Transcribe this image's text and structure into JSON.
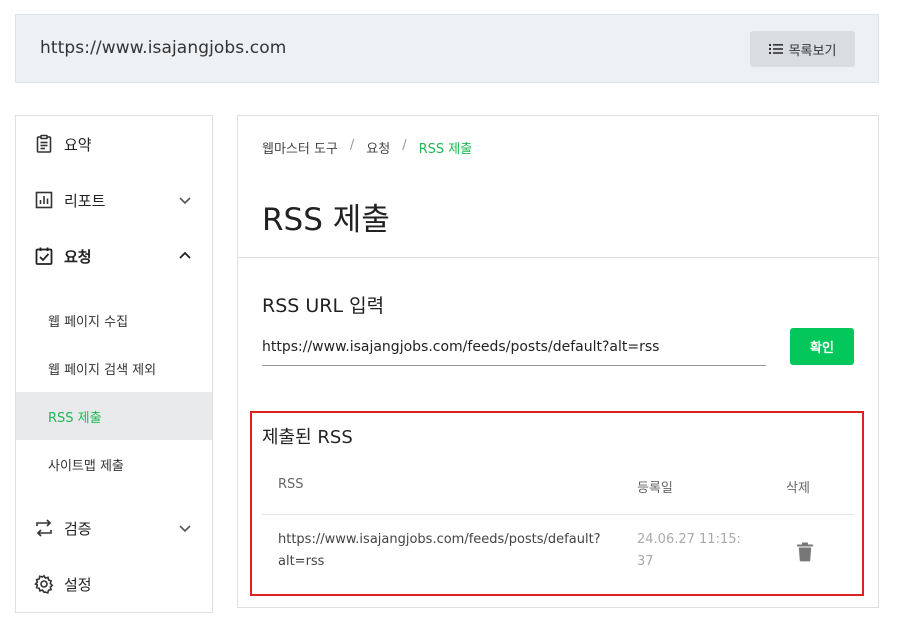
{
  "site": {
    "url": "https://www.isajangjobs.com",
    "list_button_label": "목록보기",
    "list_button_icon": "list-icon"
  },
  "sidebar": {
    "items": [
      {
        "label": "요약",
        "icon": "document-icon"
      },
      {
        "label": "리포트",
        "icon": "bar-chart-icon",
        "expanded": false
      },
      {
        "label": "요청",
        "icon": "clipboard-check-icon",
        "expanded": true
      },
      {
        "label": "웹 페이지 수집"
      },
      {
        "label": "웹 페이지 검색 제외"
      },
      {
        "label": "RSS 제출",
        "active": true
      },
      {
        "label": "사이트맵 제출"
      },
      {
        "label": "검증",
        "icon": "swap-arrows-icon",
        "expanded": false
      },
      {
        "label": "설정",
        "icon": "gear-icon"
      }
    ]
  },
  "main": {
    "breadcrumb": [
      "웹마스터 도구",
      "요청",
      "RSS 제출"
    ],
    "title": "RSS 제출",
    "url_section": {
      "label": "RSS URL 입력",
      "value": "https://www.isajangjobs.com/feeds/posts/default?alt=rss",
      "confirm_label": "확인"
    },
    "submitted": {
      "title": "제출된 RSS",
      "columns": [
        "RSS",
        "등록일",
        "삭제"
      ],
      "rows": [
        {
          "rss": "https://www.isajangjobs.com/feeds/posts/default?alt=rss",
          "date": "24.06.27 11:15:37"
        }
      ]
    }
  },
  "colors": {
    "accent": "#03c75a",
    "highlight_border": "#e02020"
  }
}
